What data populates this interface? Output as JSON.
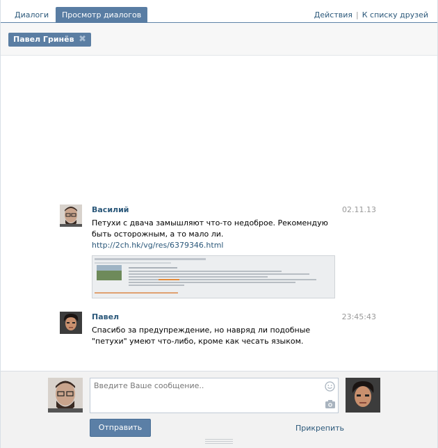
{
  "tabs": {
    "dialogs": "Диалоги",
    "view": "Просмотр диалогов"
  },
  "top_links": {
    "actions": "Действия",
    "separator": "|",
    "friends": "К списку друзей"
  },
  "peer_chip": {
    "name": "Павел Гринёв",
    "close": "✖"
  },
  "messages": [
    {
      "author": "Василий",
      "time": "02.11.13",
      "text": "Петухи с двача замышляют что-то недоброе. Рекомендую быть осторожным, а то мало ли.",
      "link": "http://2ch.hk/vg/res/6379346.html"
    },
    {
      "author": "Павел",
      "time": "23:45:43",
      "text": "Спасибо за предупреждение, но навряд ли подобные \"петухи\" умеют что-либо, кроме как чесать языком."
    }
  ],
  "composer": {
    "placeholder": "Введите Ваше сообщение..",
    "send": "Отправить",
    "attach": "Прикрепить"
  },
  "colors": {
    "accent": "#597da3",
    "link": "#2b587a"
  }
}
